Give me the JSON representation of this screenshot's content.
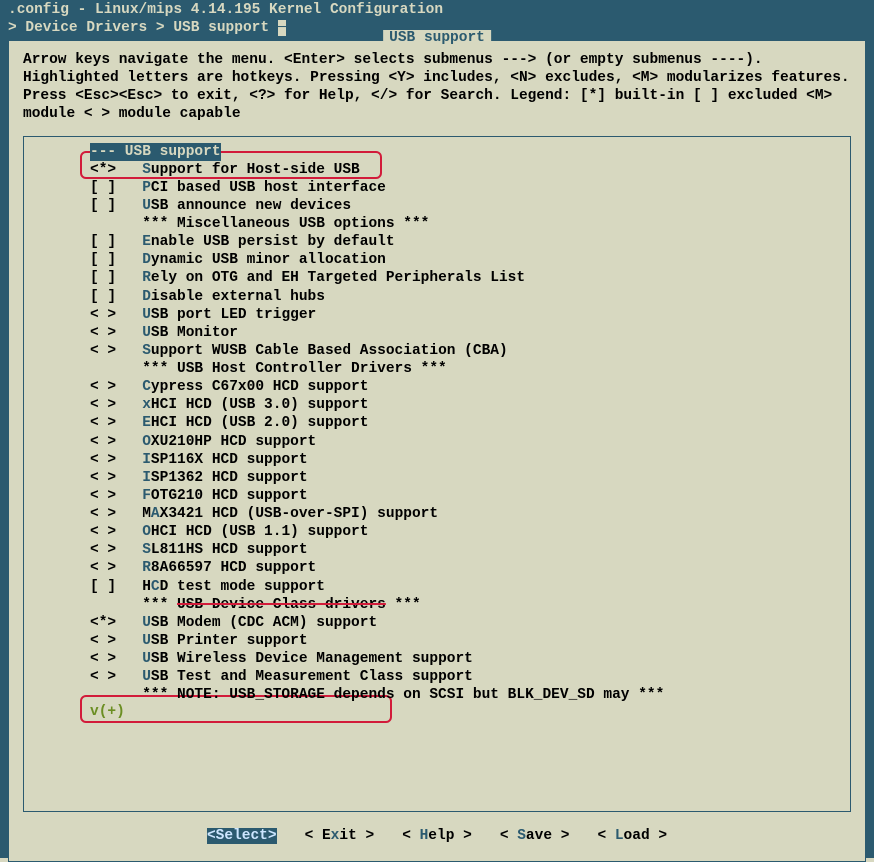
{
  "title": ".config - Linux/mips 4.14.195 Kernel Configuration",
  "breadcrumb": "> Device Drivers > USB support",
  "panel_title": " USB support ",
  "help": "Arrow keys navigate the menu.  <Enter> selects submenus ---> (or empty submenus ----). Highlighted letters are hotkeys.  Pressing <Y> includes, <N> excludes, <M> modularizes features.  Press <Esc><Esc> to exit, <?> for Help, </> for Search.  Legend: [*] built-in  [ ] excluded  <M> module  < > module capable",
  "heading": "--- USB support",
  "items": [
    {
      "m": "<*>",
      "h": "S",
      "t": "upport for Host-side USB"
    },
    {
      "m": "[ ]",
      "h": "P",
      "t": "CI based USB host interface"
    },
    {
      "m": "[ ]",
      "h": "U",
      "t": "SB announce new devices"
    },
    {
      "m": "   ",
      "h": "",
      "t": "*** Miscellaneous USB options ***"
    },
    {
      "m": "[ ]",
      "h": "E",
      "t": "nable USB persist by default"
    },
    {
      "m": "[ ]",
      "h": "D",
      "t": "ynamic USB minor allocation"
    },
    {
      "m": "[ ]",
      "h": "R",
      "t": "ely on OTG and EH Targeted Peripherals List"
    },
    {
      "m": "[ ]",
      "h": "D",
      "t": "isable external hubs"
    },
    {
      "m": "< >",
      "h": "U",
      "t": "SB port LED trigger"
    },
    {
      "m": "< >",
      "h": "U",
      "t": "SB Monitor"
    },
    {
      "m": "< >",
      "h": "S",
      "t": "upport WUSB Cable Based Association (CBA)"
    },
    {
      "m": "   ",
      "h": "",
      "t": "*** USB Host Controller Drivers ***"
    },
    {
      "m": "< >",
      "h": "C",
      "t": "ypress C67x00 HCD support"
    },
    {
      "m": "< >",
      "h": "x",
      "t": "HCI HCD (USB 3.0) support"
    },
    {
      "m": "< >",
      "h": "E",
      "t": "HCI HCD (USB 2.0) support"
    },
    {
      "m": "< >",
      "h": "O",
      "t": "XU210HP HCD support"
    },
    {
      "m": "< >",
      "h": "I",
      "t": "SP116X HCD support"
    },
    {
      "m": "< >",
      "h": "I",
      "t": "SP1362 HCD support"
    },
    {
      "m": "< >",
      "h": "F",
      "t": "OTG210 HCD support"
    },
    {
      "m": "< >",
      "h": "",
      "t": "M",
      "h2": "A",
      "t2": "X3421 HCD (USB-over-SPI) support"
    },
    {
      "m": "< >",
      "h": "O",
      "t": "HCI HCD (USB 1.1) support"
    },
    {
      "m": "< >",
      "h": "S",
      "t": "L811HS HCD support"
    },
    {
      "m": "< >",
      "h": "R",
      "t": "8A66597 HCD support"
    },
    {
      "m": "[ ]",
      "h": "",
      "t": "H",
      "h2": "C",
      "t2": "D test mode support"
    },
    {
      "m": "   ",
      "h": "",
      "t": "*** ",
      "strike": "USB Device Class drivers",
      "t2": " ***"
    },
    {
      "m": "<*>",
      "h": "U",
      "t": "SB Modem (CDC ACM) support"
    },
    {
      "m": "< >",
      "h": "U",
      "t": "SB Printer support"
    },
    {
      "m": "< >",
      "h": "U",
      "t": "SB Wireless Device Management support"
    },
    {
      "m": "< >",
      "h": "U",
      "t": "SB Test and Measurement Class support"
    },
    {
      "m": "   ",
      "h": "",
      "t": "*** NOTE: USB_STORAGE depends on SCSI but BLK_DEV_SD may ***"
    }
  ],
  "more": "v(+)",
  "buttons": {
    "select": "<Select>",
    "exit": "< Exit >",
    "help": "< Help >",
    "save": "< Save >",
    "load": "< Load >"
  }
}
